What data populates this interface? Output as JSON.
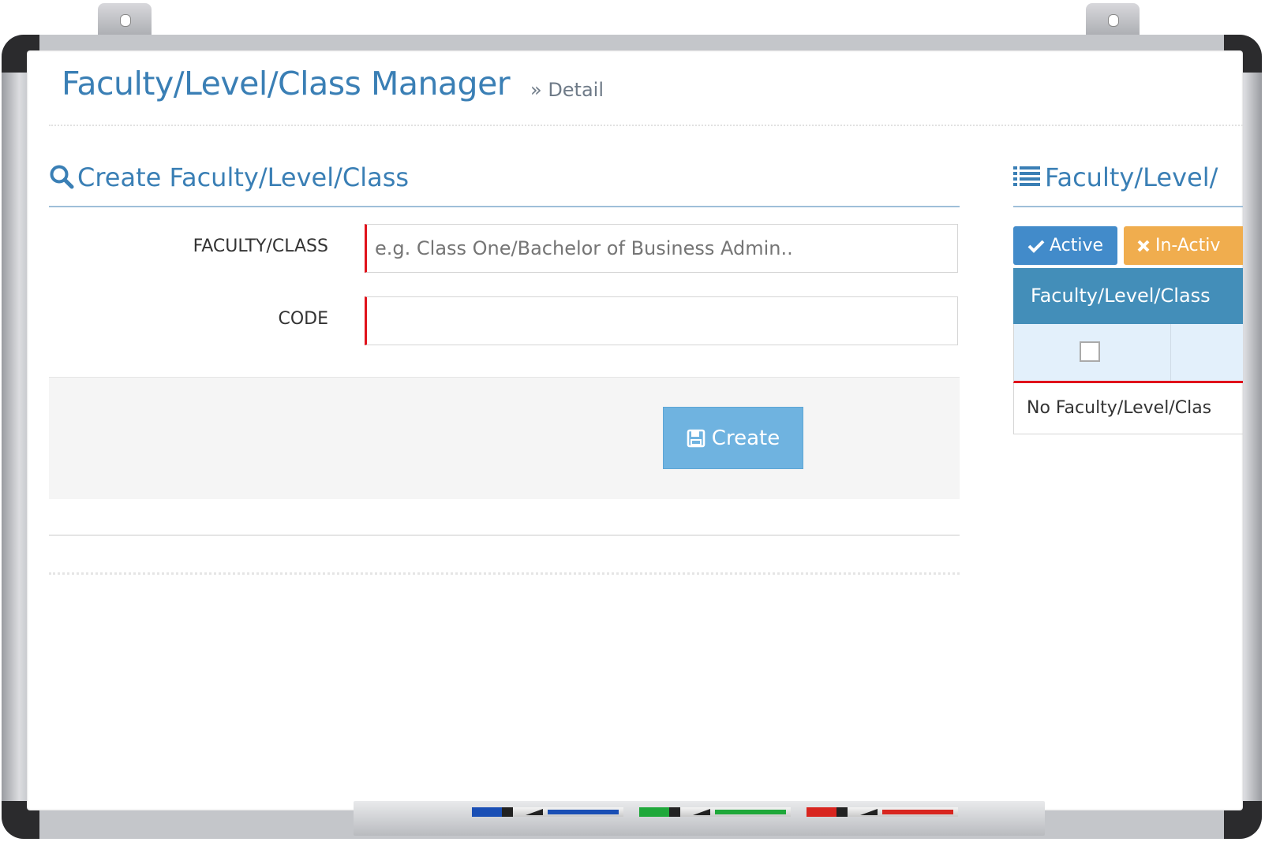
{
  "header": {
    "title": "Faculty/Level/Class Manager",
    "crumb": "» Detail"
  },
  "create_form": {
    "title": "Create Faculty/Level/Class",
    "faculty_label": "FACULTY/CLASS",
    "faculty_placeholder": "e.g. Class One/Bachelor of Business Admin..",
    "code_label": "CODE",
    "code_value": "",
    "create_label": "Create"
  },
  "list_panel": {
    "title": "Faculty/Level/",
    "active_label": "Active",
    "inactive_label": "In-Activ",
    "column_header": "Faculty/Level/Class",
    "empty_text": "No Faculty/Level/Clas"
  },
  "colors": {
    "accent": "#3a7fb5",
    "active": "#428bca",
    "inactive": "#f0ad4e",
    "create_button": "#6fb3e0",
    "table_header": "#438eb9",
    "required": "#e0121b",
    "markers": [
      "#1a4fb5",
      "#1fa83a",
      "#d8251f"
    ]
  },
  "icons": [
    "search-icon",
    "list-icon",
    "check-icon",
    "times-icon",
    "save-icon",
    "checkbox-icon"
  ]
}
